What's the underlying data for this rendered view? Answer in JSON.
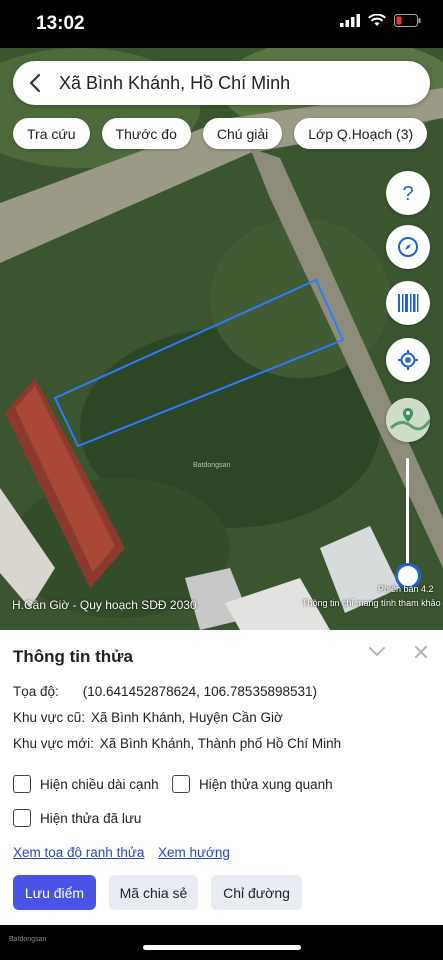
{
  "status_bar": {
    "time": "13:02"
  },
  "search": {
    "title": "Xã Bình Khánh, Hồ Chí Minh"
  },
  "chips": [
    {
      "label": "Tra cứu"
    },
    {
      "label": "Thước đo"
    },
    {
      "label": "Chú giải"
    },
    {
      "label": "Lớp Q.Hoạch (3)"
    }
  ],
  "map": {
    "layer_label": "H.Cần Giờ - Quy hoạch SDĐ 2030",
    "version": "Phiên bản 4.2",
    "note": "Thông tin chỉ mang tính tham khảo",
    "watermark": "Batdongsan",
    "parcel_outline_color": "#2f7bff"
  },
  "panel": {
    "title": "Thông tin thửa",
    "coord_label": "Tọa độ:",
    "coord_value": "(10.641452878624, 106.78535898531)",
    "old_area_label": "Khu vực cũ:",
    "old_area_value": "Xã Bình Khánh, Huyện Cần Giờ",
    "new_area_label": "Khu vực mới:",
    "new_area_value": "Xã Bình Khánh, Thành phố Hồ Chí Minh",
    "checkboxes": {
      "edge_length": "Hiện chiều dài cạnh",
      "surrounding": "Hiện thửa xung quanh",
      "saved": "Hiện thửa đã lưu"
    },
    "links": {
      "boundary": "Xem tọa độ ranh thửa",
      "direction": "Xem hướng"
    },
    "buttons": {
      "save": "Lưu điểm",
      "share": "Mã chia sẻ",
      "route": "Chỉ đường"
    }
  },
  "footer": {
    "logo_text": "Batdongsan"
  }
}
